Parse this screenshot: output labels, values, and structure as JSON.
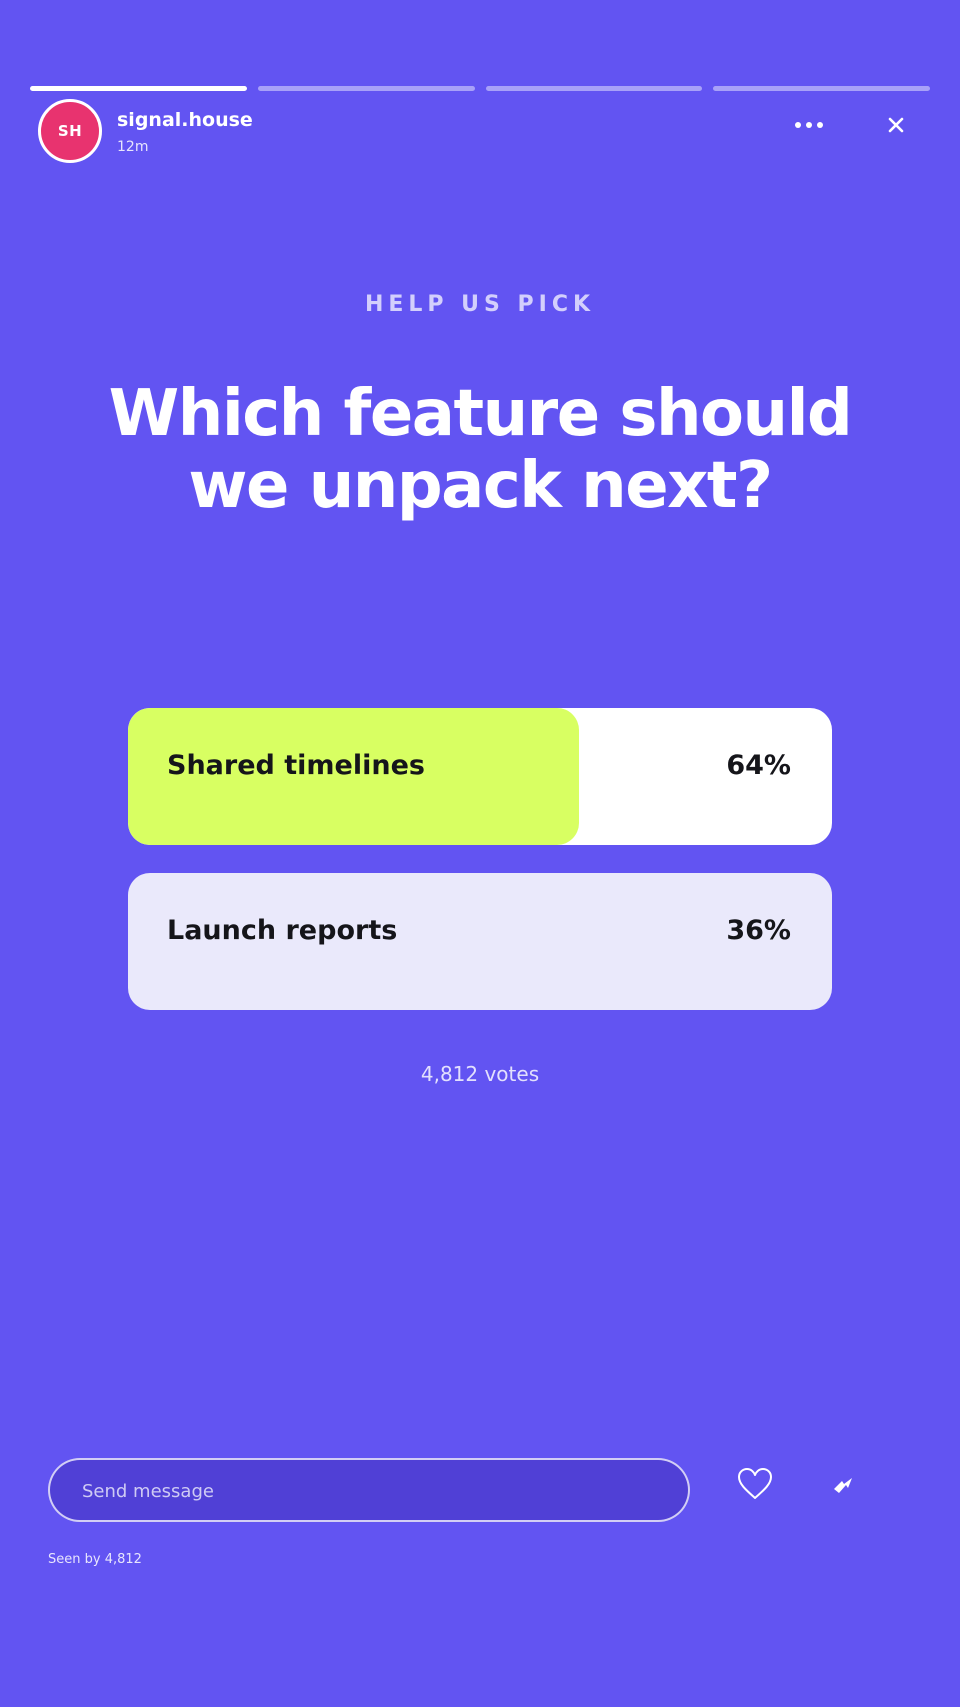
{
  "progress": [
    1,
    0,
    0,
    0
  ],
  "author": {
    "initials": "SH",
    "name": "signal.house",
    "time": "12m",
    "avatar_color": "#e8336f"
  },
  "icons": {
    "more": "more-horizontal-icon",
    "close": "close-icon",
    "heart": "heart-icon",
    "share": "share-icon"
  },
  "story": {
    "eyebrow": "HELP US PICK",
    "question_line1": "Which feature should",
    "question_line2": "we unpack next?"
  },
  "poll": {
    "options": [
      {
        "label": "Shared timelines",
        "percent": "64%",
        "fill_fraction": 0.64,
        "fill_color": "#d8ff62"
      },
      {
        "label": "Launch reports",
        "percent": "36%",
        "fill_fraction": 0.0,
        "fill_color": "#eae9fb"
      }
    ],
    "votes": "4,812 votes"
  },
  "composer": {
    "placeholder": "Send message"
  },
  "footer": {
    "seen_by": "Seen by 4,812"
  },
  "colors": {
    "background": "#6254f2",
    "accent": "#d8ff62"
  }
}
